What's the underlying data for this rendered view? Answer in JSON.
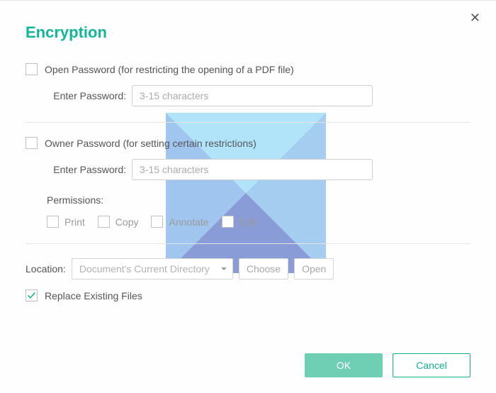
{
  "title": "Encryption",
  "open_password": {
    "checkbox_label": "Open Password (for restricting the opening of a PDF file)",
    "input_label": "Enter Password:",
    "placeholder": "3-15 characters"
  },
  "owner_password": {
    "checkbox_label": "Owner Password (for setting certain restrictions)",
    "input_label": "Enter Password:",
    "placeholder": "3-15 characters",
    "permissions_label": "Permissions:",
    "permissions": {
      "print": "Print",
      "copy": "Copy",
      "annotate": "Annotate",
      "edit": "Edit"
    }
  },
  "location": {
    "label": "Location:",
    "selected": "Document's Current Directory",
    "choose": "Choose",
    "open": "Open"
  },
  "replace_label": "Replace Existing Files",
  "buttons": {
    "ok": "OK",
    "cancel": "Cancel"
  }
}
